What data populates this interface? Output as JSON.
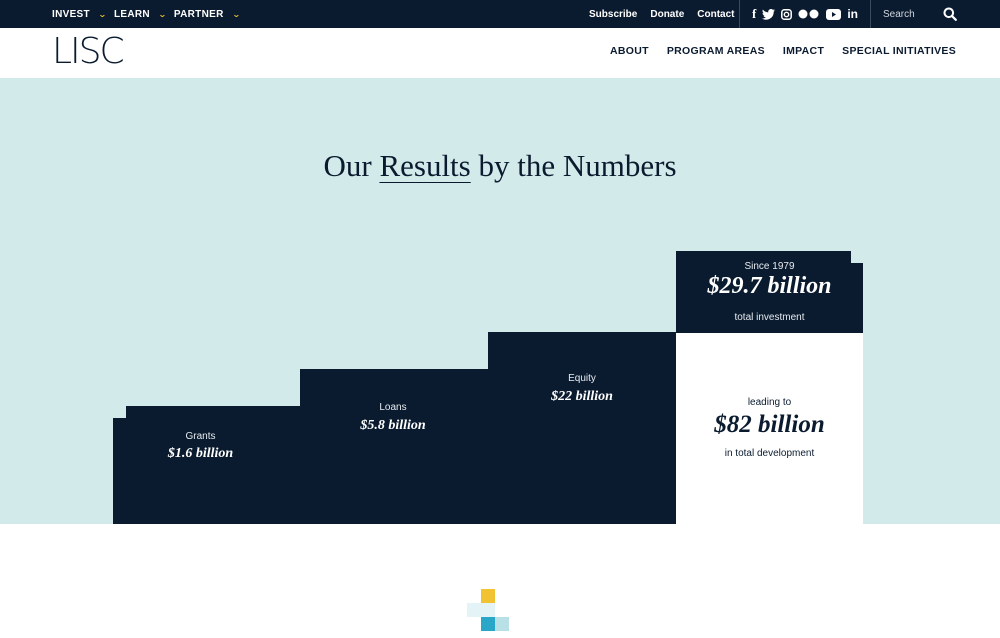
{
  "topnav": {
    "left": [
      {
        "label": "INVEST"
      },
      {
        "label": "LEARN"
      },
      {
        "label": "PARTNER"
      }
    ],
    "right": [
      {
        "label": "Subscribe"
      },
      {
        "label": "Donate"
      },
      {
        "label": "Contact"
      }
    ],
    "social": [
      "facebook-icon",
      "twitter-icon",
      "instagram-icon",
      "flickr-icon",
      "youtube-icon",
      "linkedin-icon"
    ],
    "search_placeholder": "Search"
  },
  "header": {
    "logo": "LISC",
    "nav": [
      "ABOUT",
      "PROGRAM AREAS",
      "IMPACT",
      "SPECIAL INITIATIVES"
    ]
  },
  "hero": {
    "title_pre": "Our ",
    "title_ul": "Results",
    "title_post": " by the Numbers",
    "grants": {
      "label": "Grants",
      "value": "$1.6 billion"
    },
    "loans": {
      "label": "Loans",
      "value": "$5.8 billion"
    },
    "equity": {
      "label": "Equity",
      "value": "$22 billion"
    },
    "investment": {
      "label_top": "Since 1979",
      "value": "$29.7 billion",
      "label_bottom": "total investment"
    },
    "development": {
      "label_top": "leading to",
      "value": "$82 billion",
      "label_bottom": "in total development"
    }
  },
  "colors": {
    "navy": "#0b1b2f",
    "accent_yellow": "#f1c232",
    "hero_bg": "#d3eaea",
    "accent_blue": "#2aa6c9"
  }
}
